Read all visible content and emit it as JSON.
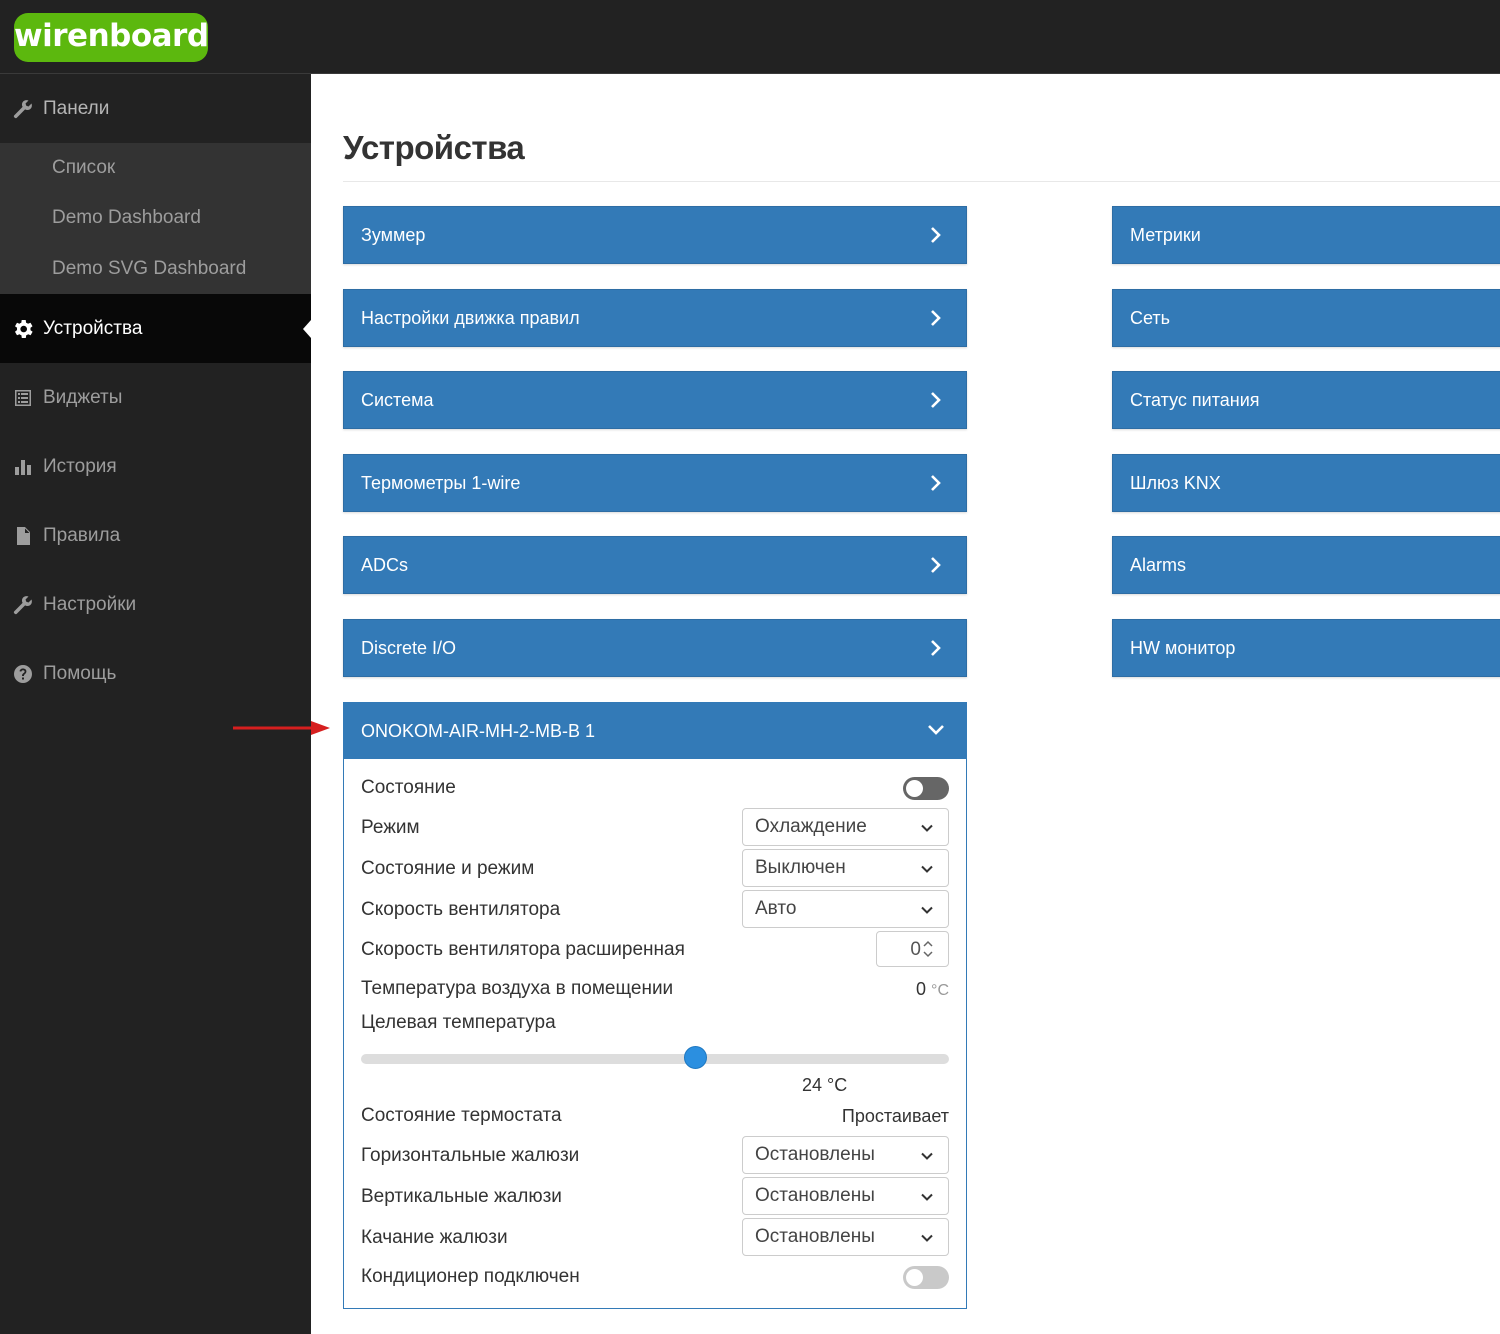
{
  "brand": {
    "logo_text": "wirenboard",
    "logo_color": "#5cb80e"
  },
  "sidebar": {
    "panels_label": "Панели",
    "sub_items": [
      "Список",
      "Demo Dashboard",
      "Demo SVG Dashboard"
    ],
    "items": [
      {
        "label": "Устройства",
        "icon": "gear-icon",
        "active": true
      },
      {
        "label": "Виджеты",
        "icon": "list-icon"
      },
      {
        "label": "История",
        "icon": "bar-chart-icon"
      },
      {
        "label": "Правила",
        "icon": "file-icon"
      },
      {
        "label": "Настройки",
        "icon": "wrench-icon"
      },
      {
        "label": "Помощь",
        "icon": "help-icon"
      }
    ]
  },
  "main": {
    "title": "Устройства",
    "left_devices": [
      "Зуммер",
      "Настройки движка правил",
      "Система",
      "Термометры 1-wire",
      "ADCs",
      "Discrete I/O"
    ],
    "right_devices": [
      "Метрики",
      "Сеть",
      "Статус питания",
      "Шлюз KNX",
      "Alarms",
      "HW монитор"
    ],
    "accent_color": "#337ab7"
  },
  "device": {
    "title": "ONOKOM-AIR-MH-2-MB-B 1",
    "state_label": "Состояние",
    "state_on": false,
    "mode_label": "Режим",
    "mode_value": "Охлаждение",
    "state_mode_label": "Состояние и режим",
    "state_mode_value": "Выключен",
    "fan_label": "Скорость вентилятора",
    "fan_value": "Авто",
    "fan_ext_label": "Скорость вентилятора расширенная",
    "fan_ext_value": "0",
    "room_temp_label": "Температура воздуха в помещении",
    "room_temp_value": "0",
    "room_temp_unit": "°C",
    "target_temp_label": "Целевая температура",
    "target_temp_value": "24 °C",
    "target_temp_fraction": 0.57,
    "thermostat_label": "Состояние термостата",
    "thermostat_value": "Простаивает",
    "hblinds_label": "Горизонтальные жалюзи",
    "hblinds_value": "Остановлены",
    "vblinds_label": "Вертикальные жалюзи",
    "vblinds_value": "Остановлены",
    "swing_label": "Качание жалюзи",
    "swing_value": "Остановлены",
    "connected_label": "Кондиционер подключен",
    "connected_on": false
  }
}
